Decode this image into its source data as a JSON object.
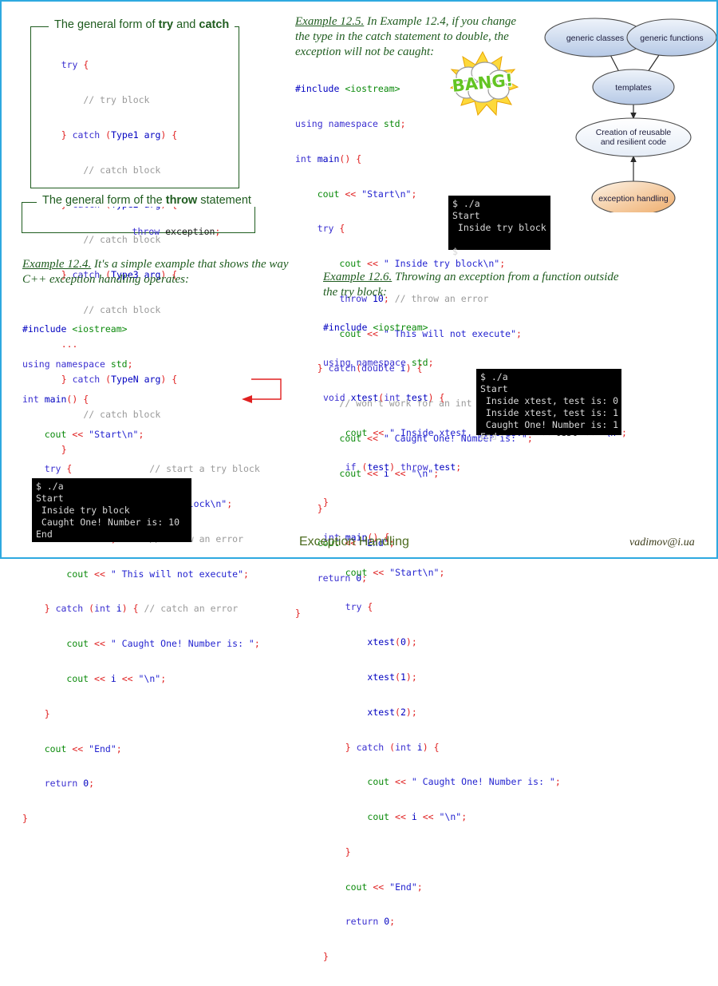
{
  "slide": {
    "border_color": "#2ea9e0",
    "footer_title": "Exception Handling",
    "footer_email": "vadimov@i.ua"
  },
  "box_try_catch": {
    "legend_pre": "The general form of ",
    "legend_b1": "try",
    "legend_mid": " and ",
    "legend_b2": "catch",
    "code": "    try {\n        // try block\n    } catch (Type1 arg) {\n        // catch block\n    } catch (Type2 arg) {\n        // catch block\n    } catch (Type3 arg) {\n        // catch block\n    ...\n    } catch (TypeN arg) {\n        // catch block\n    }"
  },
  "box_throw": {
    "legend_pre": "The general form of the ",
    "legend_b1": "throw",
    "legend_post": " statement",
    "code": "throw exception;"
  },
  "example_124": {
    "label": "Example 12.4.",
    "text": " It's a simple example that shows the way C++ exception handling operates:",
    "code": "#include <iostream>\nusing namespace std;\nint main() {\n    cout << \"Start\\n\";\n    try {              // start a try block\n        cout << \" Inside try block\\n\";\n        throw 10;      // throw an error\n        cout << \" This will not execute\";\n    } catch (int i) { // catch an error\n        cout << \" Caught One! Number is: \";\n        cout << i << \"\\n\";\n    }\n    cout << \"End\";\n    return 0;\n}",
    "terminal": "$ ./a\nStart\n Inside try block\n Caught One! Number is: 10\nEnd"
  },
  "example_125": {
    "label": "Example 12.5.",
    "text": " In Example 12.4, if you change the type in the catch statement to double, the exception will not be caught:",
    "code": "#include <iostream>\nusing namespace std;\nint main() {\n    cout << \"Start\\n\";\n    try {\n        cout << \" Inside try block\\n\";\n        throw 10; // throw an error\n        cout << \" This will not execute\";\n    } catch(double i) {\n        // won't work for an int exception\n        cout << \" Caught One! Number is: \";\n        cout << i << \"\\n\";\n    }\n    cout << \"End\";\n    return 0;\n}",
    "terminal": "$ ./a\nStart\n Inside try block\n\n$",
    "bang_text": "BANG!"
  },
  "example_126": {
    "label": "Example 12.6.",
    "text": " Throwing an exception from a function outside the try block:",
    "code": "#include <iostream>\nusing namespace std;\nvoid xtest(int test) {\n    cout << \" Inside xtest, test is: \" << test << \"\\n\";\n    if (test) throw test;\n}\nint main() {\n    cout << \"Start\\n\";\n    try {\n        xtest(0);\n        xtest(1);\n        xtest(2);\n    } catch (int i) {\n        cout << \" Caught One! Number is: \";\n        cout << i << \"\\n\";\n    }\n    cout << \"End\";\n    return 0;\n}",
    "terminal": "$ ./a\nStart\n Inside xtest, test is: 0\n Inside xtest, test is: 1\n Caught One! Number is: 1\nEnd"
  },
  "diagram": {
    "nodes": [
      {
        "id": "generic-classes",
        "label": "generic classes"
      },
      {
        "id": "generic-functions",
        "label": "generic functions"
      },
      {
        "id": "templates",
        "label": "templates"
      },
      {
        "id": "reusable-code",
        "label_line1": "Creation of reusable",
        "label_line2": "and resilient code"
      },
      {
        "id": "exception-handling",
        "label": "exception handling"
      }
    ],
    "colors": {
      "blue_fill": "#c4d3ea",
      "light_fill": "#f2f6fb",
      "orange_fill": "#f2c79a",
      "stroke": "#4a4a4a"
    }
  }
}
